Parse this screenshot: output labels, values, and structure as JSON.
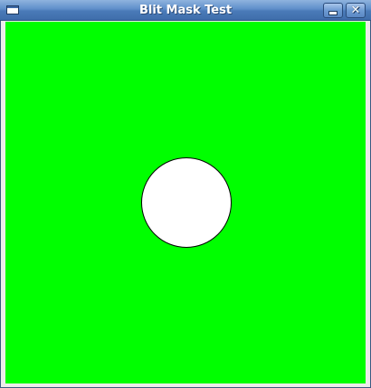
{
  "window": {
    "title": "Blit Mask Test",
    "buttons": {
      "minimize_icon": "minimize-icon",
      "close_icon": "close-icon",
      "close_glyph": "✕"
    }
  },
  "canvas": {
    "background_color": "#00ff00",
    "shape": {
      "type": "circle",
      "fill_color": "#ffffff",
      "outline_color": "#000000"
    }
  }
}
